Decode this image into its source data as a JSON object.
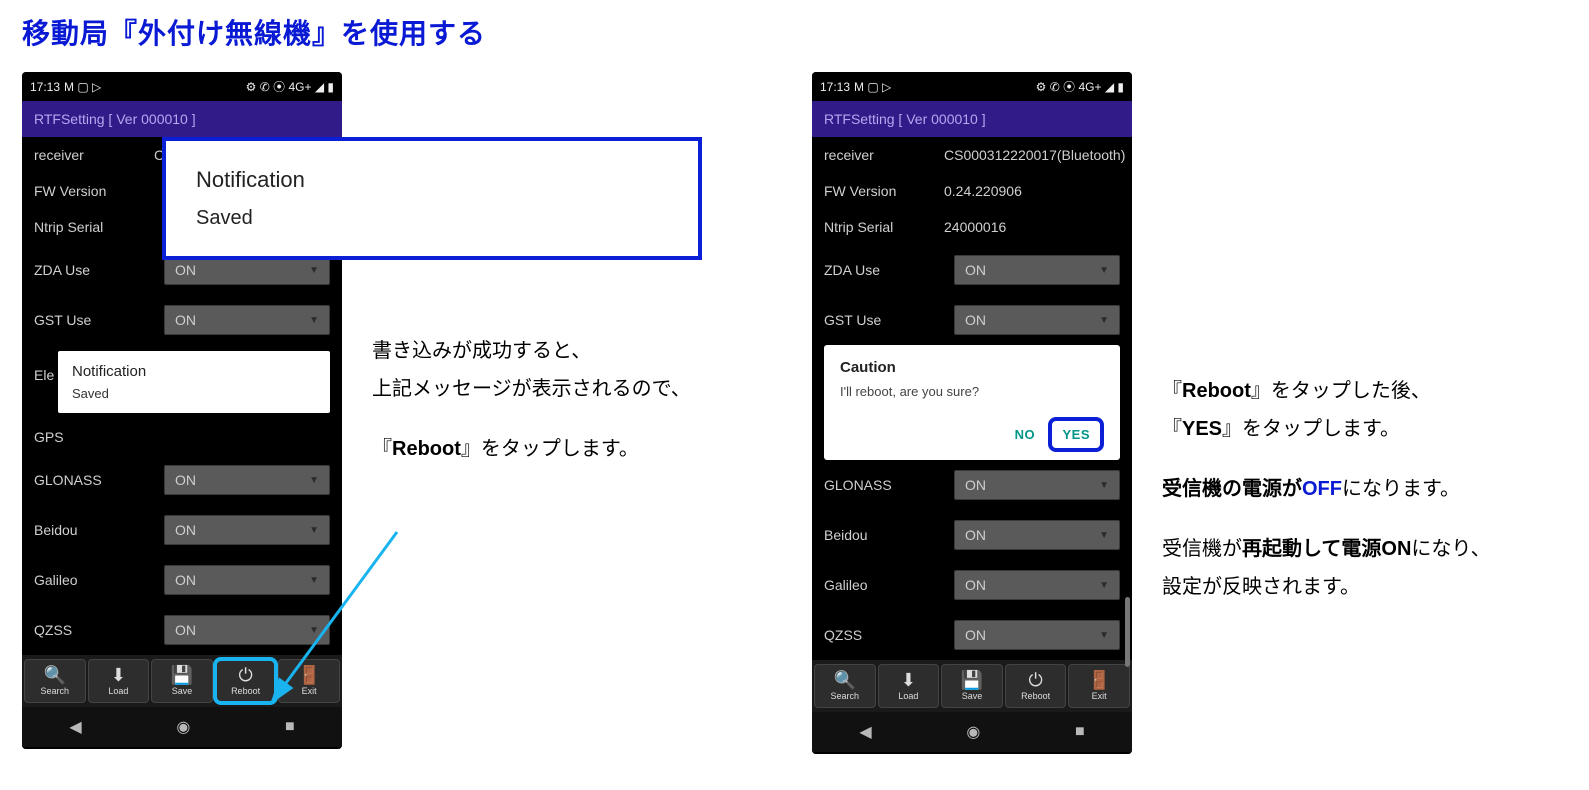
{
  "page": {
    "title": "移動局『外付け無線機』を使用する"
  },
  "statusbar": {
    "time": "17:13",
    "left_icons": "M ▢ ▷",
    "right_icons": "⚙ ✆ ⦿ 4G+ ◢ ▮"
  },
  "app": {
    "header": "RTFSetting  [ Ver 000010 ]"
  },
  "fields": {
    "receiver_label": "receiver",
    "receiver_partial": "CS",
    "receiver_full": "CS000312220017(Bluetooth)",
    "fw_label": "FW Version",
    "fw_value": "0.24.220906",
    "ntrip_label": "Ntrip Serial",
    "ntrip_value": "24000016",
    "zda_label": "ZDA Use",
    "gst_label": "GST Use",
    "el_label": "Ele",
    "el_label_short": "El",
    "gps_label": "GPS",
    "glonass_label": "GLONASS",
    "beidou_label": "Beidou",
    "galileo_label": "Galileo",
    "qzss_label": "QZSS",
    "on": "ON"
  },
  "notification_small": {
    "title": "Notification",
    "body": "Saved"
  },
  "callout": {
    "title": "Notification",
    "body": "Saved"
  },
  "caution": {
    "title": "Caution",
    "body": "I'll reboot, are you sure?",
    "no": "NO",
    "yes": "YES"
  },
  "toolbar": {
    "search": "Search",
    "load": "Load",
    "save": "Save",
    "reboot": "Reboot",
    "exit": "Exit"
  },
  "text_left": {
    "line1": "書き込みが成功すると、",
    "line2": "上記メッセージが表示されるので、",
    "line3a": "『",
    "line3b": "Reboot",
    "line3c": "』をタップします。"
  },
  "text_right": {
    "l1a": "『",
    "l1b": "Reboot",
    "l1c": "』をタップした後、",
    "l2a": "『",
    "l2b": "YES",
    "l2c": "』をタップします。",
    "l3a": "受信機の電源が",
    "l3b": "OFF",
    "l3c": "になります。",
    "l4a": "受信機が",
    "l4b": "再起動して電源ON",
    "l4c": "になり、",
    "l5": "設定が反映されます。"
  }
}
